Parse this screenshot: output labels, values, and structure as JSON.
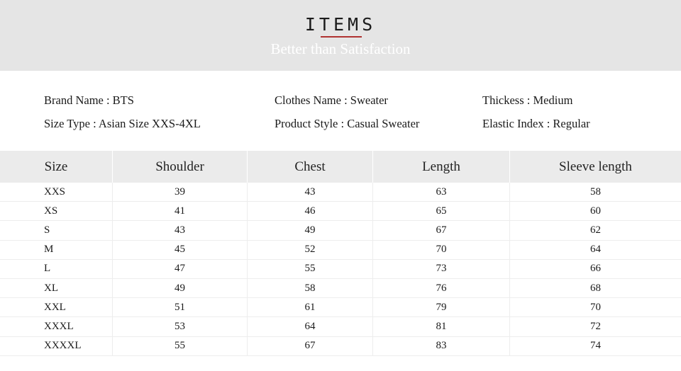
{
  "banner": {
    "title": "ITEMS",
    "subtitle": "Better than Satisfaction",
    "rule_color": "#b03231",
    "background_color": "#e5e5e5"
  },
  "info": {
    "columns": [
      {
        "lines": [
          "Brand Name : BTS",
          "Size Type : Asian Size XXS-4XL"
        ]
      },
      {
        "lines": [
          "Clothes Name : Sweater",
          "Product Style : Casual Sweater"
        ]
      },
      {
        "lines": [
          "Thickess : Medium",
          "Elastic Index : Regular"
        ]
      }
    ]
  },
  "size_table": {
    "headers": [
      "Size",
      "Shoulder",
      "Chest",
      "Length",
      "Sleeve length"
    ],
    "rows": [
      [
        "XXS",
        "39",
        "43",
        "63",
        "58"
      ],
      [
        "XS",
        "41",
        "46",
        "65",
        "60"
      ],
      [
        "S",
        "43",
        "49",
        "67",
        "62"
      ],
      [
        "M",
        "45",
        "52",
        "70",
        "64"
      ],
      [
        "L",
        "47",
        "55",
        "73",
        "66"
      ],
      [
        "XL",
        "49",
        "58",
        "76",
        "68"
      ],
      [
        "XXL",
        "51",
        "61",
        "79",
        "70"
      ],
      [
        "XXXL",
        "53",
        "64",
        "81",
        "72"
      ],
      [
        "XXXXL",
        "55",
        "67",
        "83",
        "74"
      ]
    ]
  }
}
